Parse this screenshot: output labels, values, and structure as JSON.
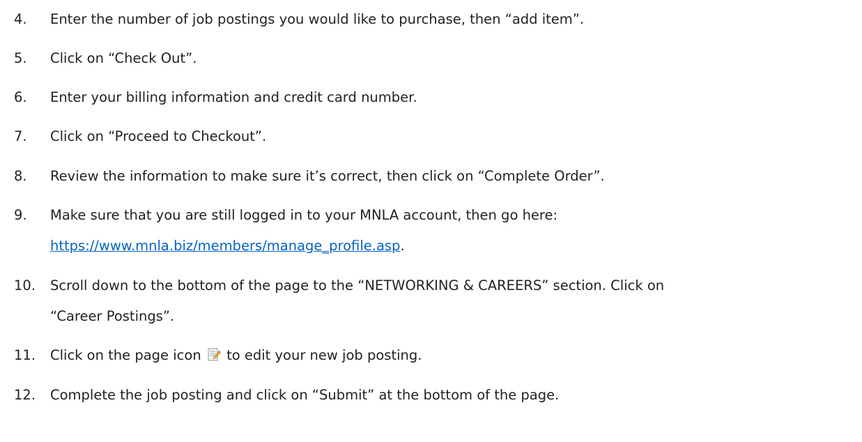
{
  "steps": [
    {
      "num": "4.",
      "text": "Enter the number of job postings you would like to purchase, then “add item”."
    },
    {
      "num": "5.",
      "text": "Click on “Check Out”."
    },
    {
      "num": "6.",
      "text": "Enter your billing information and credit card number."
    },
    {
      "num": "7.",
      "text": "Click on “Proceed to Checkout”."
    },
    {
      "num": "8.",
      "text": "Review the information to make sure it’s correct, then click on “Complete Order”."
    },
    {
      "num": "9.",
      "text": "Make sure that you are still logged in to your MNLA account, then go here:",
      "link": "https://www.mnla.biz/members/manage_profile.asp",
      "after_link": "."
    },
    {
      "num": "10.",
      "text": "Scroll down to the bottom of the page to the “NETWORKING & CAREERS” section. Click on",
      "cont": "“Career Postings”."
    },
    {
      "num": "11.",
      "text_before": "Click on the page icon",
      "icon": "edit-page-icon",
      "text_after": "to edit your new job posting."
    },
    {
      "num": "12.",
      "text": "Complete the job posting and click on “Submit” at the bottom of the page."
    }
  ]
}
